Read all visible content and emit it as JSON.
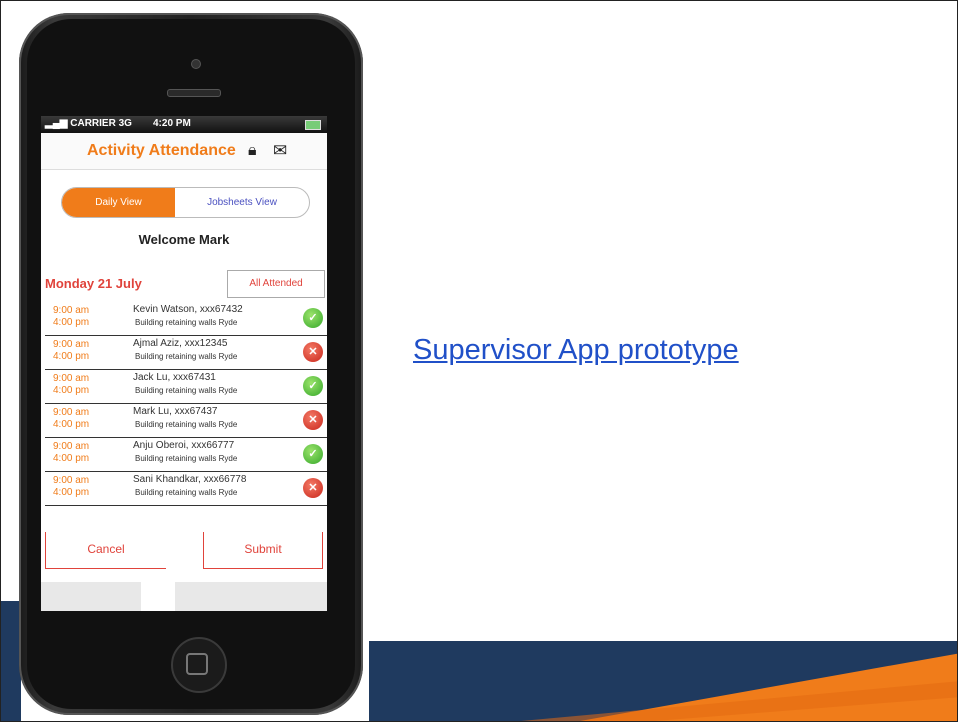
{
  "slide": {
    "link_text": "Supervisor App prototype",
    "colors": {
      "accent_orange": "#f07c1a",
      "accent_red": "#e0433b",
      "navy": "#1f3a5f",
      "link_blue": "#2050c8"
    }
  },
  "phone": {
    "status_bar": {
      "carrier": "CARRIER",
      "network": "3G",
      "time": "4:20 PM"
    },
    "header": {
      "title": "Activity Attendance",
      "lock_icon": "lock-icon",
      "mail_icon": "mail-icon"
    },
    "segment": {
      "active": "Daily View",
      "inactive": "Jobsheets View"
    },
    "welcome": "Welcome Mark",
    "date_heading": "Monday 21 July",
    "all_attended_label": "All Attended",
    "rows": [
      {
        "start": "9:00 am",
        "end": "4:00 pm",
        "name": "Kevin Watson, xxx67432",
        "place": "Building retaining walls Ryde",
        "status": "attended"
      },
      {
        "start": "9:00 am",
        "end": "4:00 pm",
        "name": "Ajmal Aziz, xxx12345",
        "place": "Building retaining walls Ryde",
        "status": "absent"
      },
      {
        "start": "9:00 am",
        "end": "4:00 pm",
        "name": "Jack Lu, xxx67431",
        "place": "Building retaining walls Ryde",
        "status": "attended"
      },
      {
        "start": "9:00 am",
        "end": "4:00 pm",
        "name": "Mark Lu, xxx67437",
        "place": "Building retaining walls Ryde",
        "status": "absent"
      },
      {
        "start": "9:00 am",
        "end": "4:00 pm",
        "name": "Anju Oberoi, xxx66777",
        "place": "Building retaining walls Ryde",
        "status": "attended"
      },
      {
        "start": "9:00 am",
        "end": "4:00 pm",
        "name": "Sani Khandkar, xxx66778",
        "place": "Building retaining walls Ryde",
        "status": "absent"
      }
    ],
    "cancel_label": "Cancel",
    "submit_label": "Submit"
  }
}
